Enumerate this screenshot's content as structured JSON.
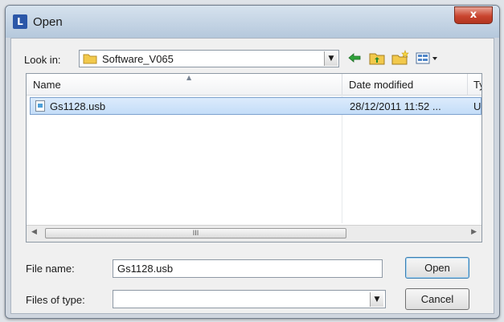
{
  "window": {
    "title": "Open",
    "app_icon_letter": "L"
  },
  "toolbar": {
    "look_in_label": "Look in:",
    "look_in_value": "Software_V065",
    "icons": [
      "back-arrow-icon",
      "up-folder-icon",
      "new-folder-icon",
      "view-menu-icon"
    ]
  },
  "file_list": {
    "columns": [
      "Name",
      "Date modified",
      "Ty"
    ],
    "rows": [
      {
        "name": "Gs1128.usb",
        "date": "28/12/2011 11:52 ...",
        "type": "U:"
      }
    ],
    "scroll_thumb_glyph": "III"
  },
  "form": {
    "file_name_label": "File name:",
    "file_name_value": "Gs1128.usb",
    "file_type_label": "Files of type:",
    "file_type_value": ""
  },
  "buttons": {
    "open": "Open",
    "cancel": "Cancel",
    "close": "x"
  }
}
